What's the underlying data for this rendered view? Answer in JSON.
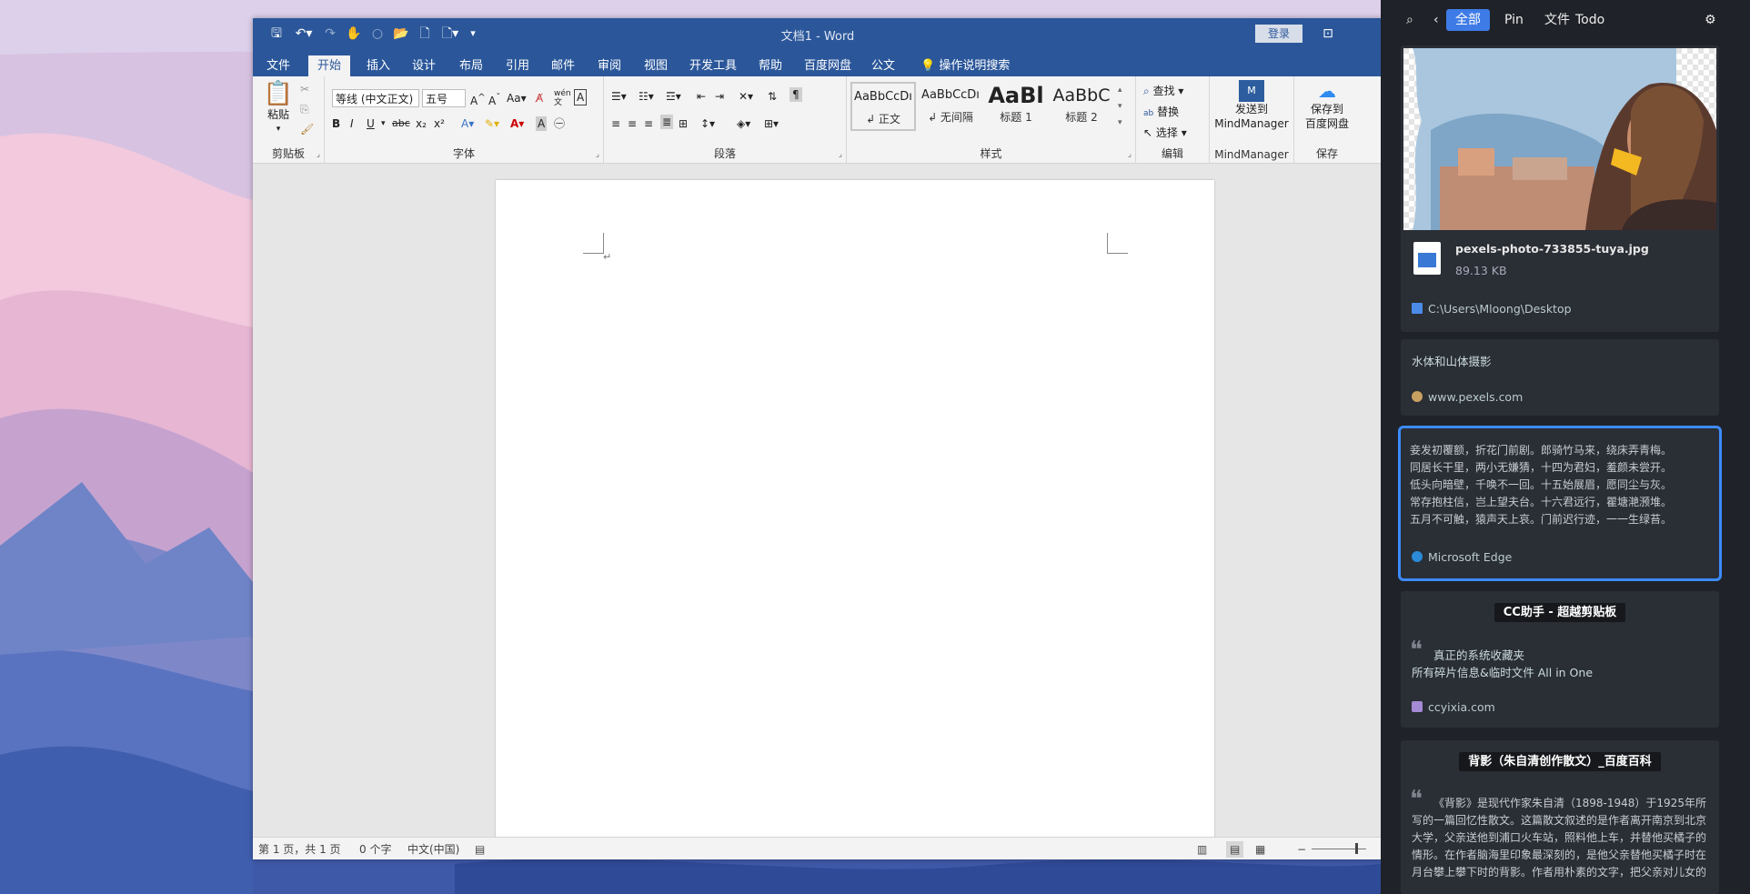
{
  "word": {
    "doc_title": "文档1 - Word",
    "login_label": "登录",
    "tabs": [
      "文件",
      "开始",
      "插入",
      "设计",
      "布局",
      "引用",
      "邮件",
      "审阅",
      "视图",
      "开发工具",
      "帮助",
      "百度网盘",
      "公文"
    ],
    "active_tab": "开始",
    "tell_me": "操作说明搜索",
    "clipboard": {
      "paste_label": "粘贴",
      "group_label": "剪贴板"
    },
    "font": {
      "family": "等线 (中文正文)",
      "size": "五号",
      "group_label": "字体",
      "bold": "B",
      "italic": "I",
      "underline": "U",
      "strike": "abc",
      "sub": "x₂",
      "sup": "x²",
      "change_case": "Aa"
    },
    "paragraph": {
      "group_label": "段落"
    },
    "styles": {
      "group_label": "样式",
      "items": [
        {
          "sample": "AaBbCcDı",
          "name": "↲ 正文"
        },
        {
          "sample": "AaBbCcDı",
          "name": "↲ 无间隔"
        },
        {
          "sample": "AaBl",
          "name": "标题 1"
        },
        {
          "sample": "AaBbC",
          "name": "标题 2"
        }
      ]
    },
    "editing": {
      "group_label": "编辑",
      "find": "查找",
      "replace": "替换",
      "select": "选择"
    },
    "mindmanager": {
      "label_line1": "发送到",
      "label_line2": "MindManager",
      "group_label": "MindManager"
    },
    "save": {
      "label_line1": "保存到",
      "label_line2": "百度网盘",
      "group_label": "保存"
    },
    "status": {
      "page": "第 1 页，共 1 页",
      "words": "0 个字",
      "language": "中文(中国)"
    }
  },
  "panel": {
    "tabs": [
      "全部",
      "Pin",
      "文件",
      "Todo"
    ],
    "active_tab": "全部",
    "accent": "#3e7be6",
    "cards": {
      "image": {
        "filename": "pexels-photo-733855-tuya.jpg",
        "size": "89.13 KB",
        "path": "C:\\Users\\Mloong\\Desktop"
      },
      "link": {
        "title": "水体和山体摄影",
        "source": "www.pexels.com"
      },
      "poem": {
        "lines": [
          "妾发初覆额，折花门前剧。郎骑竹马来，绕床弄青梅。",
          "同居长干里，两小无嫌猜，十四为君妇，羞颜未尝开。",
          "低头向暗壁，千唤不一回。十五始展眉，愿同尘与灰。",
          "常存抱柱信，岂上望夫台。十六君远行，瞿塘滟滪堆。",
          "五月不可触，猿声天上哀。门前迟行迹，一一生绿苔。"
        ],
        "source": "Microsoft Edge"
      },
      "cc": {
        "title": "CC助手 - 超越剪贴板",
        "line1": "真正的系统收藏夹",
        "line2": "所有碎片信息&临时文件 All in One",
        "source": "ccyixia.com"
      },
      "baike": {
        "title": "背影（朱自清创作散文）_百度百科",
        "lines": [
          "《背影》是现代作家朱自清（1898-1948）于1925年所",
          "写的一篇回忆性散文。这篇散文叙述的是作者离开南京到北京",
          "大学，父亲送他到浦口火车站，照料他上车，并替他买橘子的",
          "情形。在作者脑海里印象最深刻的，是他父亲替他买橘子时在",
          "月台攀上攀下时的背影。作者用朴素的文字，把父亲对儿女的"
        ]
      }
    }
  }
}
